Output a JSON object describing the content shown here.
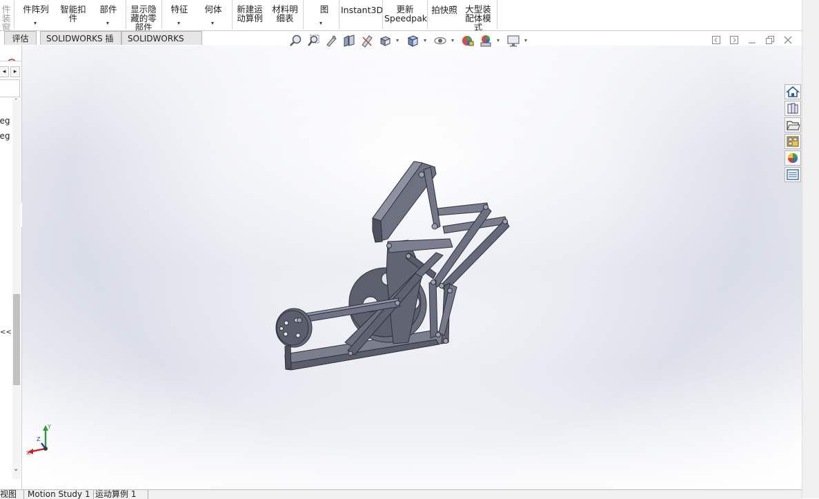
{
  "ribbon": {
    "buttons": [
      {
        "label": "件\n装窗",
        "greyed": true
      },
      {
        "label": "件阵列"
      },
      {
        "label": "智能扣\n件"
      },
      {
        "label": "部件"
      },
      {
        "label": "显示隐\n藏的零\n部件"
      },
      {
        "label": "特征"
      },
      {
        "label": "何体"
      },
      {
        "label": "新建运\n动算例"
      },
      {
        "label": "材料明\n细表"
      },
      {
        "label": "图"
      },
      {
        "label": "Instant3D"
      },
      {
        "label": "更新\nSpeedpak"
      },
      {
        "label": "拍快照"
      },
      {
        "label": "大型装\n配体模\n式"
      }
    ]
  },
  "tabs": [
    {
      "label": "评估"
    },
    {
      "label": "SOLIDWORKS 插件"
    },
    {
      "label": "SOLIDWORKS MBD"
    }
  ],
  "left_panel": {
    "items": [
      "Leg",
      "Leg"
    ],
    "collapse_label": "<<"
  },
  "hud_icons": [
    "zoom-to-fit-icon",
    "zoom-to-area-icon",
    "previous-view-icon",
    "section-view-icon",
    "dynamic-annotation-icon",
    "view-orientation-icon",
    "display-style-icon",
    "hide-show-items-icon",
    "edit-appearance-icon",
    "apply-scene-icon",
    "view-settings-icon"
  ],
  "triad": {
    "x": "X",
    "y": "Y",
    "z": "Z"
  },
  "bottom_tabs": [
    {
      "label": "视图"
    },
    {
      "label": "Motion Study 1"
    },
    {
      "label": "运动算例 1"
    }
  ],
  "colors": {
    "model": "#5e6170",
    "model_dark": "#3a3c46",
    "model_light": "#8a8d9c",
    "accent": "#1e5fb5"
  }
}
